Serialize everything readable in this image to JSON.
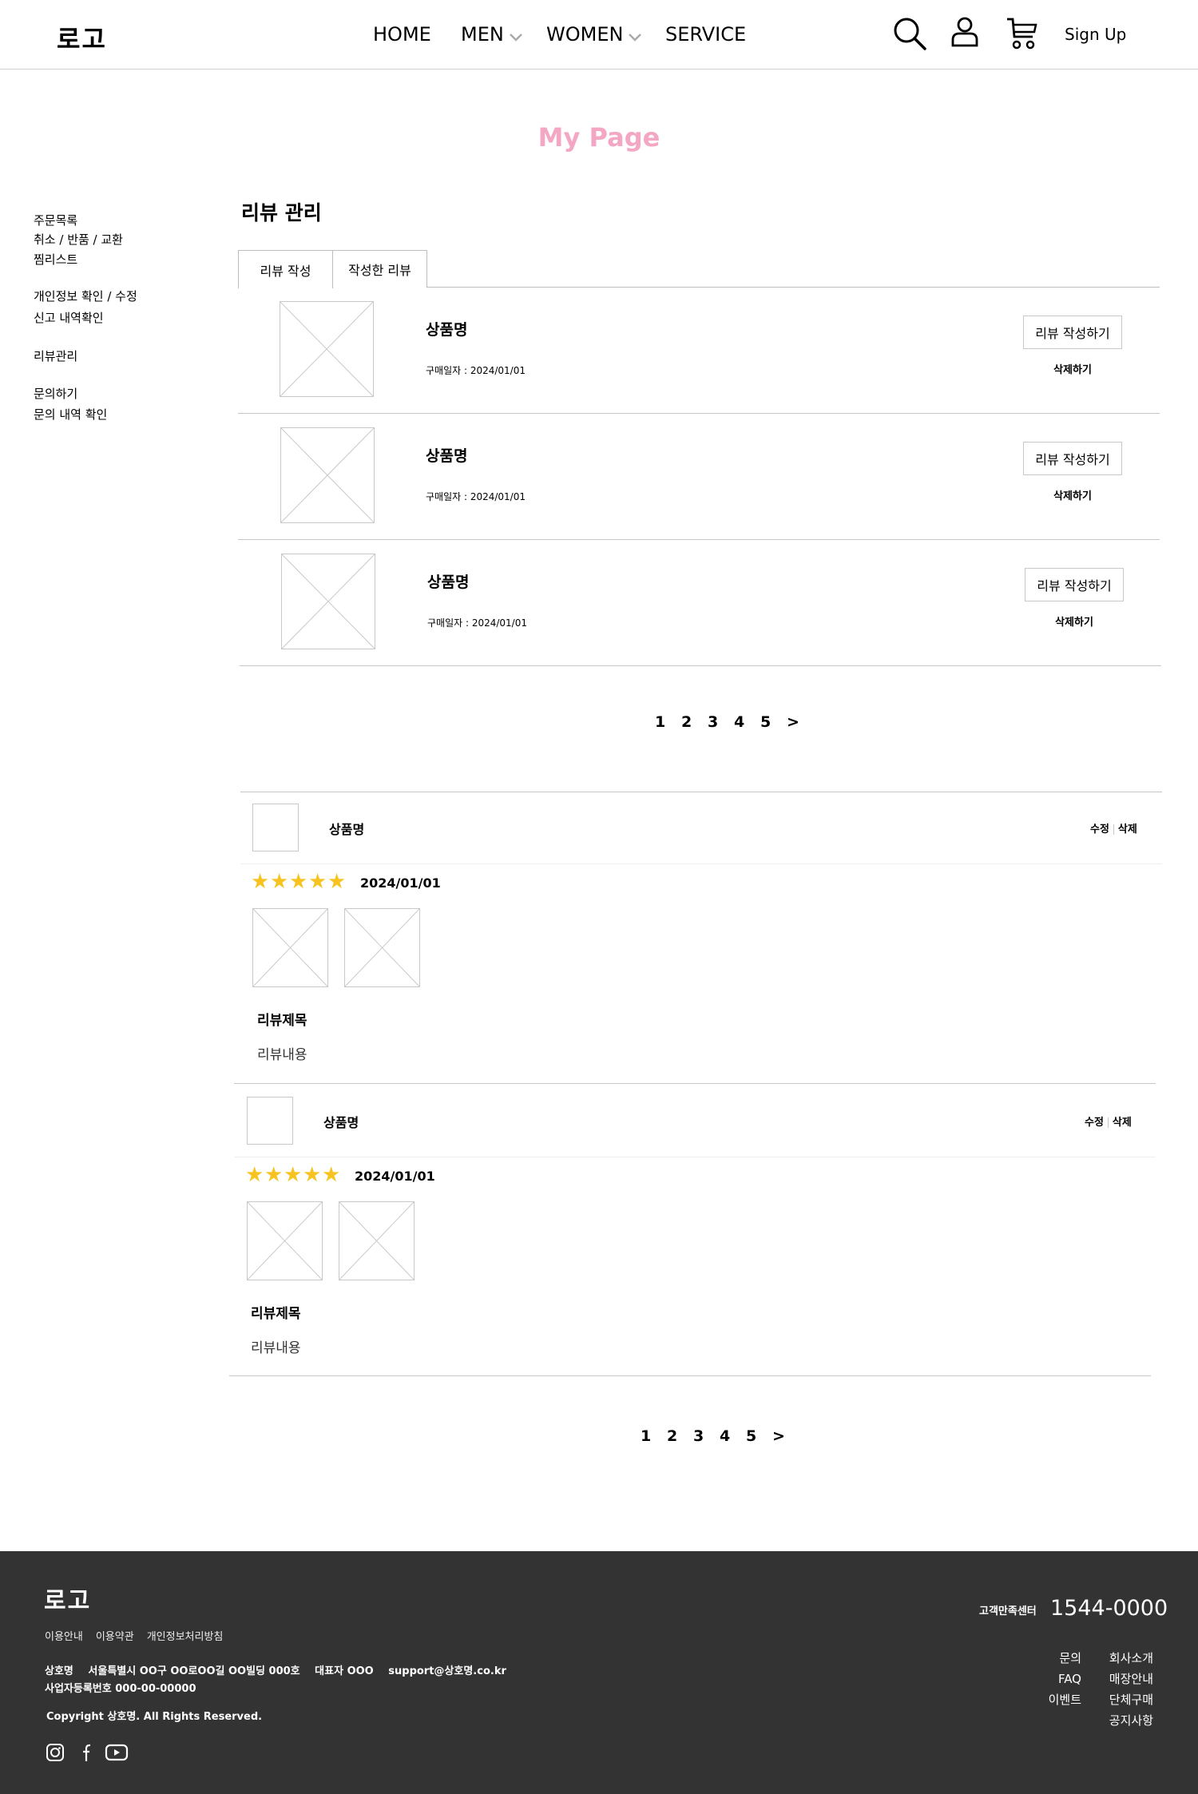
{
  "header": {
    "logo": "로고",
    "nav": [
      "HOME",
      "MEN",
      "WOMEN",
      "SERVICE"
    ],
    "signup": "Sign Up",
    "icons": [
      "search-icon",
      "user-icon",
      "cart-icon"
    ]
  },
  "page_title": "My Page",
  "sidebar": {
    "items": [
      "주문목록",
      "취소 / 반품 / 교환",
      "찜리스트",
      "개인정보 확인 / 수정",
      "신고 내역확인",
      "리뷰관리",
      "문의하기",
      "문의 내역 확인"
    ]
  },
  "section_title": "리뷰 관리",
  "tabs": [
    "리뷰 작성",
    "작성한 리뷰"
  ],
  "orders": [
    {
      "name": "상품명",
      "date": "구매일자 : 2024/01/01",
      "button": "리뷰 작성하기",
      "delete": "삭제하기"
    },
    {
      "name": "상품명",
      "date": "구매일자 : 2024/01/01",
      "button": "리뷰 작성하기",
      "delete": "삭제하기"
    },
    {
      "name": "상품명",
      "date": "구매일자 : 2024/01/01",
      "button": "리뷰 작성하기",
      "delete": "삭제하기"
    }
  ],
  "pagination": [
    "1",
    "2",
    "3",
    "4",
    "5",
    ">"
  ],
  "reviews": [
    {
      "name": "상품명",
      "edit": "수정",
      "delete": "삭제",
      "rating": 5,
      "stars": "★★★★★",
      "date": "2024/01/01",
      "title": "리뷰제목",
      "content": "리뷰내용"
    },
    {
      "name": "상품명",
      "edit": "수정",
      "delete": "삭제",
      "rating": 5,
      "stars": "★★★★★",
      "date": "2024/01/01",
      "title": "리뷰제목",
      "content": "리뷰내용"
    }
  ],
  "footer": {
    "logo": "로고",
    "links": [
      "이용안내",
      "이용약관",
      "개인정보처리방침"
    ],
    "company": "상호명",
    "address": "서울특별시 OO구 OO로OO길 OO빌딩 000호",
    "ceo": "대표자 OOO",
    "email": "support@상호명.co.kr",
    "biz_no": "사업자등록번호 000-00-00000",
    "copyright": "Copyright 상호명. All Rights Reserved.",
    "cs_label": "고객만족센터",
    "cs_phone": "1544-0000",
    "menu_left": [
      "문의",
      "FAQ",
      "이벤트"
    ],
    "menu_right": [
      "회사소개",
      "매장안내",
      "단체구매",
      "공지사항"
    ],
    "social": [
      "instagram-icon",
      "facebook-icon",
      "youtube-icon"
    ]
  },
  "colors": {
    "title_pink": "#f4a7c4",
    "star": "#f6c320",
    "footer_bg": "#333333"
  }
}
